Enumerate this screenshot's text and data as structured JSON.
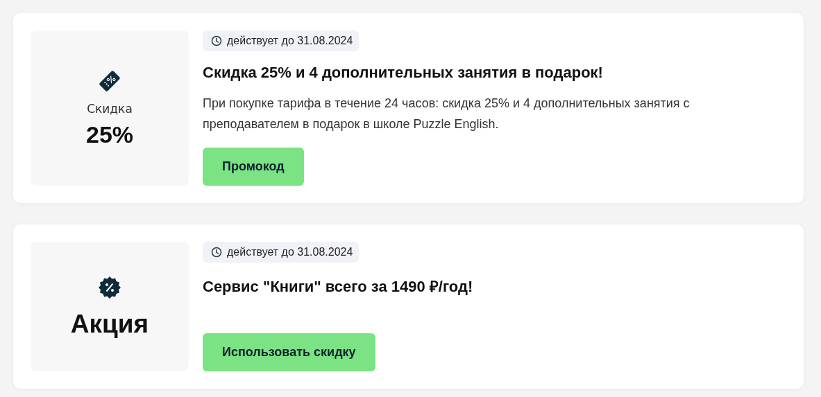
{
  "offers": [
    {
      "kind": "discount",
      "badge_label": "Скидка",
      "badge_value": "25%",
      "validity": "действует до 31.08.2024",
      "title": "Скидка 25% и 4 дополнительных занятия в подарок!",
      "description": "При покупке тарифа в течение 24 часов: скидка 25% и 4 дополнительных занятия с преподавателем в подарок в школе Puzzle English.",
      "button": "Промокод"
    },
    {
      "kind": "promo",
      "badge_label": "Акция",
      "validity": "действует до 31.08.2024",
      "title": "Сервис \"Книги\" всего за 1490 ₽/год!",
      "button": "Использовать скидку"
    }
  ]
}
